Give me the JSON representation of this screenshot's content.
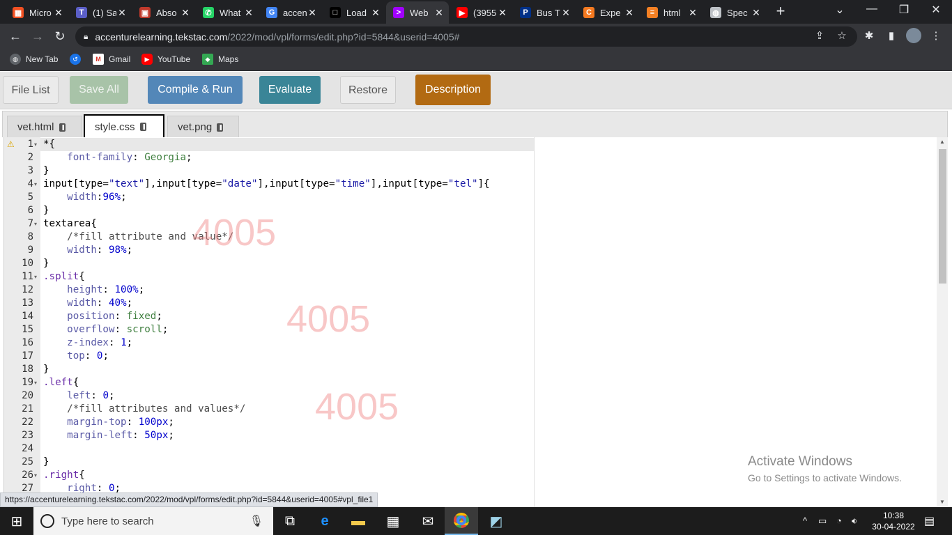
{
  "browser": {
    "tabs": [
      {
        "title": "Micro",
        "icon": "microsoft-icon",
        "color": "#f25022"
      },
      {
        "title": "(1) Sa",
        "icon": "teams-icon",
        "color": "#5b5fc7"
      },
      {
        "title": "Abso",
        "icon": "briefcase-icon",
        "color": "#c0392b"
      },
      {
        "title": "What",
        "icon": "whatsapp-icon",
        "color": "#25d366"
      },
      {
        "title": "accen",
        "icon": "google-icon",
        "color": "#4285f4"
      },
      {
        "title": "Load",
        "icon": "page-icon",
        "color": "#000000"
      },
      {
        "title": "Web",
        "icon": "accenture-icon",
        "color": "#a100ff"
      },
      {
        "title": "(3955",
        "icon": "youtube-icon",
        "color": "#ff0000"
      },
      {
        "title": "Bus T",
        "icon": "paypal-icon",
        "color": "#003087"
      },
      {
        "title": "Expe",
        "icon": "c-icon",
        "color": "#f47920"
      },
      {
        "title": "html",
        "icon": "stackoverflow-icon",
        "color": "#f48024"
      },
      {
        "title": "Spec",
        "icon": "globe-icon",
        "color": "#bdc1c6"
      }
    ],
    "url_host": "accenturelearning.tekstac.com",
    "url_path": "/2022/mod/vpl/forms/edit.php?id=5844&userid=4005#",
    "bookmarks": [
      {
        "label": "New Tab",
        "icon": "globe-icon"
      },
      {
        "label": "",
        "icon": "history-icon"
      },
      {
        "label": "Gmail",
        "icon": "gmail-icon"
      },
      {
        "label": "YouTube",
        "icon": "youtube-icon"
      },
      {
        "label": "Maps",
        "icon": "maps-icon"
      }
    ]
  },
  "vpl": {
    "buttons": {
      "file_list": "File List",
      "save_all": "Save All",
      "compile_run": "Compile & Run",
      "evaluate": "Evaluate",
      "restore": "Restore",
      "description": "Description"
    },
    "colors": {
      "compile": "#5387b8",
      "evaluate": "#3a8597",
      "description": "#b26a12",
      "save_disabled": "#a8c3a8"
    },
    "file_tabs": [
      "vet.html",
      "style.css",
      "vet.png"
    ],
    "active_file": "style.css",
    "watermark": "4005",
    "line_numbers": [
      "1",
      "2",
      "3",
      "4",
      "5",
      "6",
      "7",
      "8",
      "9",
      "10",
      "11",
      "12",
      "13",
      "14",
      "15",
      "16",
      "17",
      "18",
      "19",
      "20",
      "21",
      "22",
      "23",
      "24",
      "25",
      "26",
      "27"
    ]
  },
  "overlay": {
    "activate_title": "Activate Windows",
    "activate_sub": "Go to Settings to activate Windows.",
    "status_url": "https://accenturelearning.tekstac.com/2022/mod/vpl/forms/edit.php?id=5844&userid=4005#vpl_file1"
  },
  "taskbar": {
    "search_placeholder": "Type here to search",
    "time": "10:38",
    "date": "30-04-2022"
  }
}
